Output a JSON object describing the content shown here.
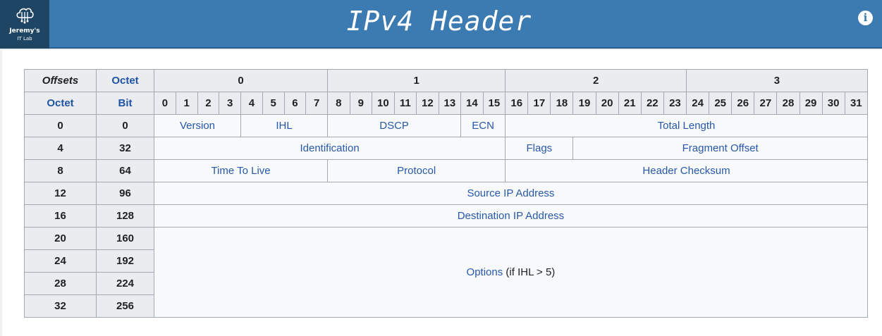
{
  "logo": {
    "line1": "Jeremy's",
    "line2": "IT Lab"
  },
  "title": "IPv4 Header",
  "info_icon": "i",
  "table": {
    "offsets_label": "Offsets",
    "octet_label": "Octet",
    "bit_label": "Bit",
    "octet_groups": [
      "0",
      "1",
      "2",
      "3"
    ],
    "bits": [
      "0",
      "1",
      "2",
      "3",
      "4",
      "5",
      "6",
      "7",
      "8",
      "9",
      "10",
      "11",
      "12",
      "13",
      "14",
      "15",
      "16",
      "17",
      "18",
      "19",
      "20",
      "21",
      "22",
      "23",
      "24",
      "25",
      "26",
      "27",
      "28",
      "29",
      "30",
      "31"
    ],
    "rows": [
      {
        "octet": "0",
        "bit": "0",
        "fields": [
          "Version",
          "IHL",
          "DSCP",
          "ECN",
          "Total Length"
        ]
      },
      {
        "octet": "4",
        "bit": "32",
        "fields": [
          "Identification",
          "Flags",
          "Fragment Offset"
        ]
      },
      {
        "octet": "8",
        "bit": "64",
        "fields": [
          "Time To Live",
          "Protocol",
          "Header Checksum"
        ]
      },
      {
        "octet": "12",
        "bit": "96",
        "fields": [
          "Source IP Address"
        ]
      },
      {
        "octet": "16",
        "bit": "128",
        "fields": [
          "Destination IP Address"
        ]
      },
      {
        "octet": "20",
        "bit": "160"
      },
      {
        "octet": "24",
        "bit": "192"
      },
      {
        "octet": "28",
        "bit": "224"
      },
      {
        "octet": "32",
        "bit": "256"
      }
    ],
    "options_link": "Options",
    "options_note": " (if IHL > 5)"
  }
}
